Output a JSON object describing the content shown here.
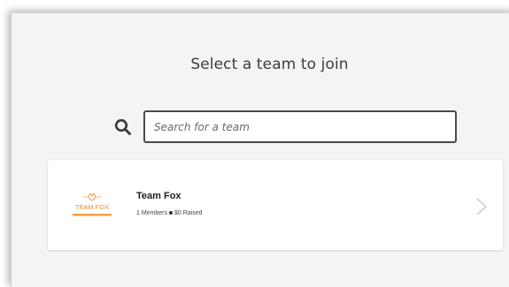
{
  "page": {
    "title": "Select a team to join"
  },
  "search": {
    "placeholder": "Search for a team",
    "value": "",
    "icon": "search-icon"
  },
  "teams": [
    {
      "name": "Team Fox",
      "logo": {
        "text": "TEAM FOX",
        "icon": "fox-logo-icon",
        "color": "#f28c28"
      },
      "members": "1 Members",
      "raised": "$0 Raised",
      "chevron_icon": "chevron-right-icon"
    }
  ],
  "colors": {
    "panel_background": "#f4f4f4",
    "card_background": "#ffffff",
    "logo_orange": "#f28c28",
    "input_border": "#4a4a4a"
  }
}
